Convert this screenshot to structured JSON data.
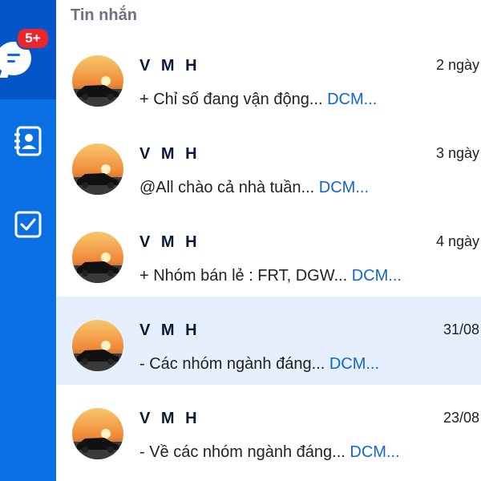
{
  "sidebar": {
    "badge": "5+",
    "items": [
      {
        "icon": "chat-icon",
        "active": true
      },
      {
        "icon": "contacts-icon",
        "active": false
      },
      {
        "icon": "todo-check-icon",
        "active": false
      }
    ]
  },
  "header": {
    "title": "Tin nhắn"
  },
  "messages": [
    {
      "sender": "V M H",
      "time": "2 ngày",
      "preview": "+ Chỉ số đang vận động...",
      "tag": "DCM...",
      "selected": false
    },
    {
      "sender": "V M H",
      "time": "3 ngày",
      "preview": "@All chào cả nhà tuần...",
      "tag": "DCM...",
      "selected": false
    },
    {
      "sender": "V M H",
      "time": "4 ngày",
      "preview": "+ Nhóm bán lẻ : FRT, DGW...",
      "tag": "DCM...",
      "selected": false
    },
    {
      "sender": "V M H",
      "time": "31/08",
      "preview": "- Các nhóm ngành đáng...",
      "tag": "DCM...",
      "selected": true
    },
    {
      "sender": "V M H",
      "time": "23/08",
      "preview": "- Về các nhóm ngành đáng...",
      "tag": "DCM...",
      "selected": false
    }
  ],
  "colors": {
    "sidebar": "#0a6fe3",
    "sidebar_active": "#0456c8",
    "badge": "#e8262b",
    "selected_row": "#e5effd",
    "tag": "#1565d0"
  }
}
